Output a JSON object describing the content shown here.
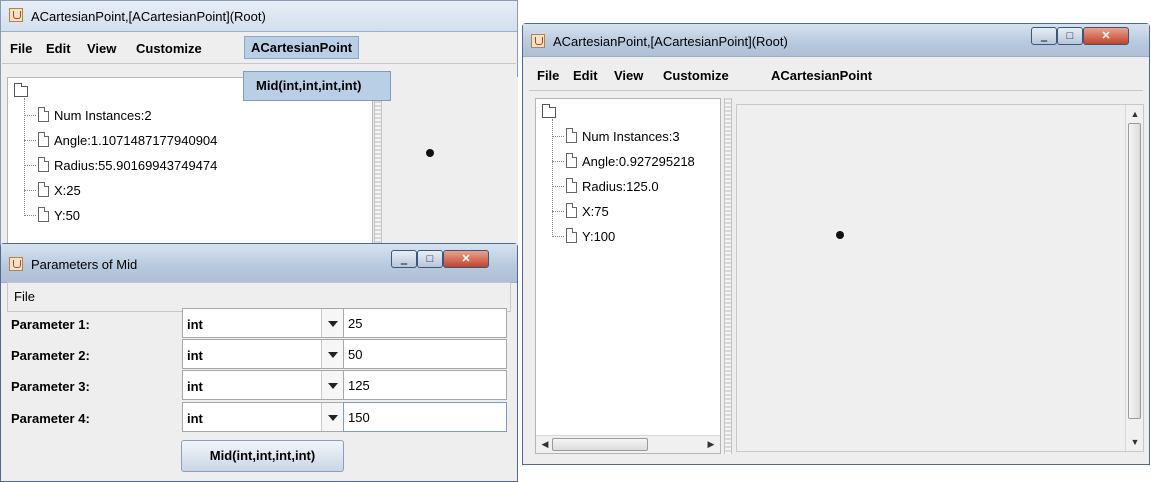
{
  "win1": {
    "title": "ACartesianPoint,[ACartesianPoint](Root)",
    "menu": [
      "File",
      "Edit",
      "View",
      "Customize",
      "ACartesianPoint"
    ],
    "popup_item": "Mid(int,int,int,int)",
    "tree": [
      "Num Instances:2",
      "Angle:1.1071487177940904",
      "Radius:55.90169943749474",
      "X:25",
      "Y:50"
    ]
  },
  "win2": {
    "title": "Parameters of Mid",
    "menu": [
      "File"
    ],
    "params": [
      {
        "label": "Parameter 1:",
        "type": "int",
        "value": "25"
      },
      {
        "label": "Parameter 2:",
        "type": "int",
        "value": "50"
      },
      {
        "label": "Parameter 3:",
        "type": "int",
        "value": "125"
      },
      {
        "label": "Parameter 4:",
        "type": "int",
        "value": "150"
      }
    ],
    "button": "Mid(int,int,int,int)"
  },
  "win3": {
    "title": "ACartesianPoint,[ACartesianPoint](Root)",
    "menu": [
      "File",
      "Edit",
      "View",
      "Customize",
      "ACartesianPoint"
    ],
    "tree": [
      "Num Instances:3",
      "Angle:0.927295218",
      "Radius:125.0",
      "X:75",
      "Y:100"
    ]
  },
  "icons": {
    "app": "java-icon",
    "minimize": "minimize-icon",
    "maximize": "maximize-icon",
    "close": "close-icon",
    "tree_root": "folder-icon",
    "tree_leaf": "document-icon",
    "point": "point-dot-icon"
  }
}
